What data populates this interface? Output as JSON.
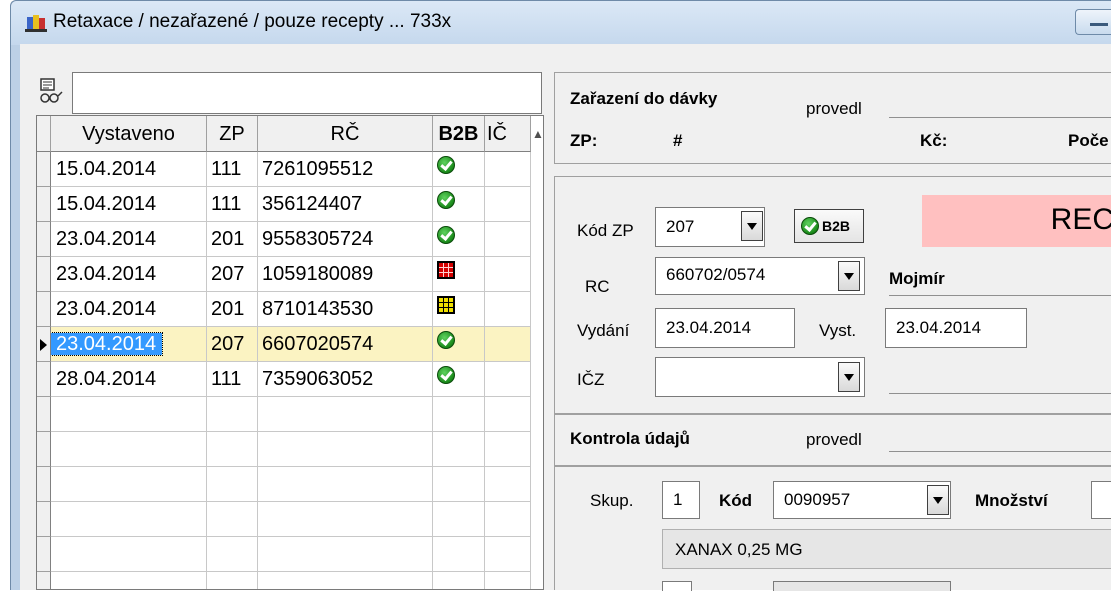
{
  "window": {
    "title": "Retaxace / nezařazené / pouze recepty ... 733x"
  },
  "colors": {
    "selected_row": "#fbf3c2",
    "selected_cell": "#3399ff",
    "status_box": "#ffc0c0",
    "ok_icon": "#1a8a1a",
    "error_icon": "#d40000",
    "warn_icon": "#f0e000"
  },
  "search": {
    "value": ""
  },
  "table": {
    "headers": [
      "Vystaveno",
      "ZP",
      "RČ",
      "B2B",
      "IČ"
    ],
    "rows": [
      {
        "date": "15.04.2014",
        "zp": "111",
        "rc": "7261095512",
        "b2b": "ok-icon"
      },
      {
        "date": "15.04.2014",
        "zp": "111",
        "rc": "356124407",
        "b2b": "ok-icon"
      },
      {
        "date": "23.04.2014",
        "zp": "201",
        "rc": "9558305724",
        "b2b": "ok-icon"
      },
      {
        "date": "23.04.2014",
        "zp": "207",
        "rc": "1059180089",
        "b2b": "error-icon"
      },
      {
        "date": "23.04.2014",
        "zp": "201",
        "rc": "8710143530",
        "b2b": "warning-icon"
      },
      {
        "date": "23.04.2014",
        "zp": "207",
        "rc": "6607020574",
        "b2b": "ok-icon",
        "selected": true
      },
      {
        "date": "28.04.2014",
        "zp": "111",
        "rc": "7359063052",
        "b2b": "ok-icon"
      }
    ]
  },
  "zarazeni": {
    "heading": "Zařazení do dávky",
    "provedl_label": "provedl",
    "zp_label": "ZP:",
    "hash_label": "#",
    "kc_label": "Kč:",
    "poc_label": "Poče"
  },
  "form": {
    "kod_zp_label": "Kód ZP",
    "kod_zp_value": "207",
    "b2b_button": "B2B",
    "status_text": "REC",
    "rc_label": "RC",
    "rc_value": "660702/0574",
    "name": "Mojmír",
    "vydani_label": "Vydání",
    "vydani_value": "23.04.2014",
    "vyst_label": "Vyst.",
    "vyst_value": "23.04.2014",
    "icz_label": "IČZ",
    "icz_value": ""
  },
  "kontrola": {
    "heading": "Kontrola údajů",
    "provedl_label": "provedl"
  },
  "item": {
    "skup_label": "Skup.",
    "skup_value": "1",
    "kod_label": "Kód",
    "kod_value": "0090957",
    "mnozstvi_label": "Množství",
    "drug_name": "XANAX 0,25 MG"
  }
}
